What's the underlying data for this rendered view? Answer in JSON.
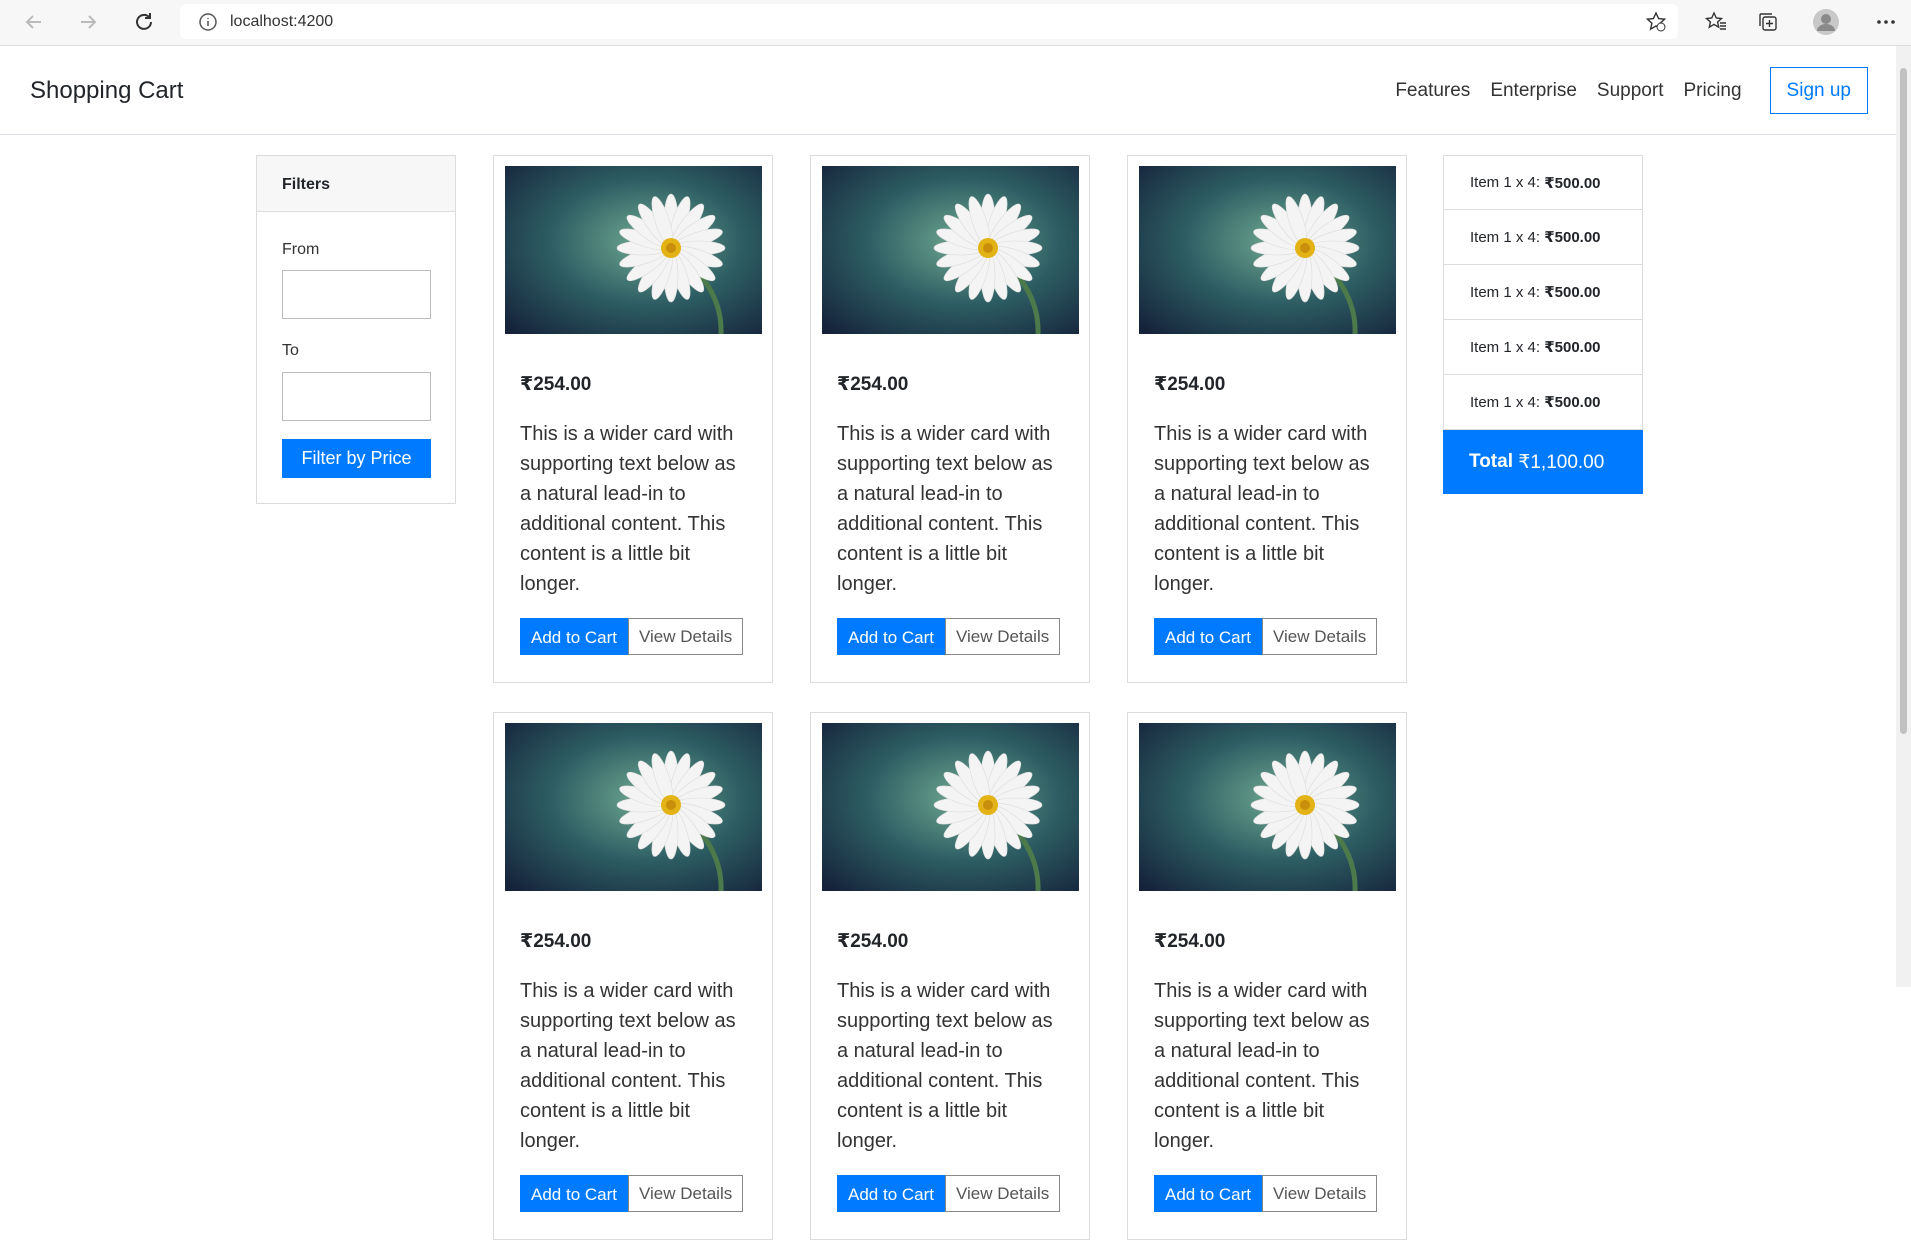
{
  "browser": {
    "url": "localhost:4200"
  },
  "app": {
    "brand": "Shopping Cart",
    "nav": [
      "Features",
      "Enterprise",
      "Support",
      "Pricing"
    ],
    "signup": "Sign up"
  },
  "filters": {
    "title": "Filters",
    "from_label": "From",
    "from_value": "",
    "to_label": "To",
    "to_value": "",
    "button": "Filter by Price"
  },
  "cards": [
    {
      "price": "₹254.00",
      "text": "This is a wider card with supporting text below as a natural lead-in to additional content. This content is a little bit longer.",
      "add": "Add to Cart",
      "view": "View Details"
    },
    {
      "price": "₹254.00",
      "text": "This is a wider card with supporting text below as a natural lead-in to additional content. This content is a little bit longer.",
      "add": "Add to Cart",
      "view": "View Details"
    },
    {
      "price": "₹254.00",
      "text": "This is a wider card with supporting text below as a natural lead-in to additional content. This content is a little bit longer.",
      "add": "Add to Cart",
      "view": "View Details"
    },
    {
      "price": "₹254.00",
      "text": "This is a wider card with supporting text below as a natural lead-in to additional content. This content is a little bit longer.",
      "add": "Add to Cart",
      "view": "View Details"
    },
    {
      "price": "₹254.00",
      "text": "This is a wider card with supporting text below as a natural lead-in to additional content. This content is a little bit longer.",
      "add": "Add to Cart",
      "view": "View Details"
    },
    {
      "price": "₹254.00",
      "text": "This is a wider card with supporting text below as a natural lead-in to additional content. This content is a little bit longer.",
      "add": "Add to Cart",
      "view": "View Details"
    }
  ],
  "cart": {
    "items": [
      {
        "label": "Item 1 x 4:",
        "amount": "₹500.00"
      },
      {
        "label": "Item 1 x 4:",
        "amount": "₹500.00"
      },
      {
        "label": "Item 1 x 4:",
        "amount": "₹500.00"
      },
      {
        "label": "Item 1 x 4:",
        "amount": "₹500.00"
      },
      {
        "label": "Item 1 x 4:",
        "amount": "₹500.00"
      }
    ],
    "total_label": "Total",
    "total_amount": "₹1,100.00"
  },
  "colors": {
    "primary": "#007bff"
  },
  "icons": [
    "back-arrow-icon",
    "forward-arrow-icon",
    "refresh-icon",
    "info-icon",
    "add-favorite-icon",
    "favorites-icon",
    "collections-icon",
    "profile-icon",
    "more-icon",
    "daisy-image"
  ]
}
